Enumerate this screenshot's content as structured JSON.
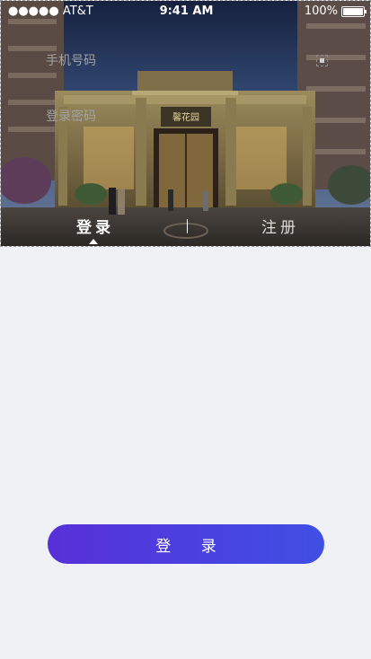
{
  "status_bar": {
    "carrier": "●●●●● AT&T",
    "time": "9:41 AM",
    "battery_percent": "100%",
    "battery_level": 1.0
  },
  "hero": {
    "building_sign": "馨花园"
  },
  "tabs": {
    "login": "登录",
    "register": "注册",
    "active": "login"
  },
  "form": {
    "phone_placeholder": "手机号码",
    "password_placeholder": "登录密码",
    "submit_label": "登 录"
  },
  "colors": {
    "background": "#f0f1f5",
    "button_gradient_start": "#5730d8",
    "button_gradient_end": "#3f4fe4",
    "placeholder": "#a3a3a3"
  }
}
